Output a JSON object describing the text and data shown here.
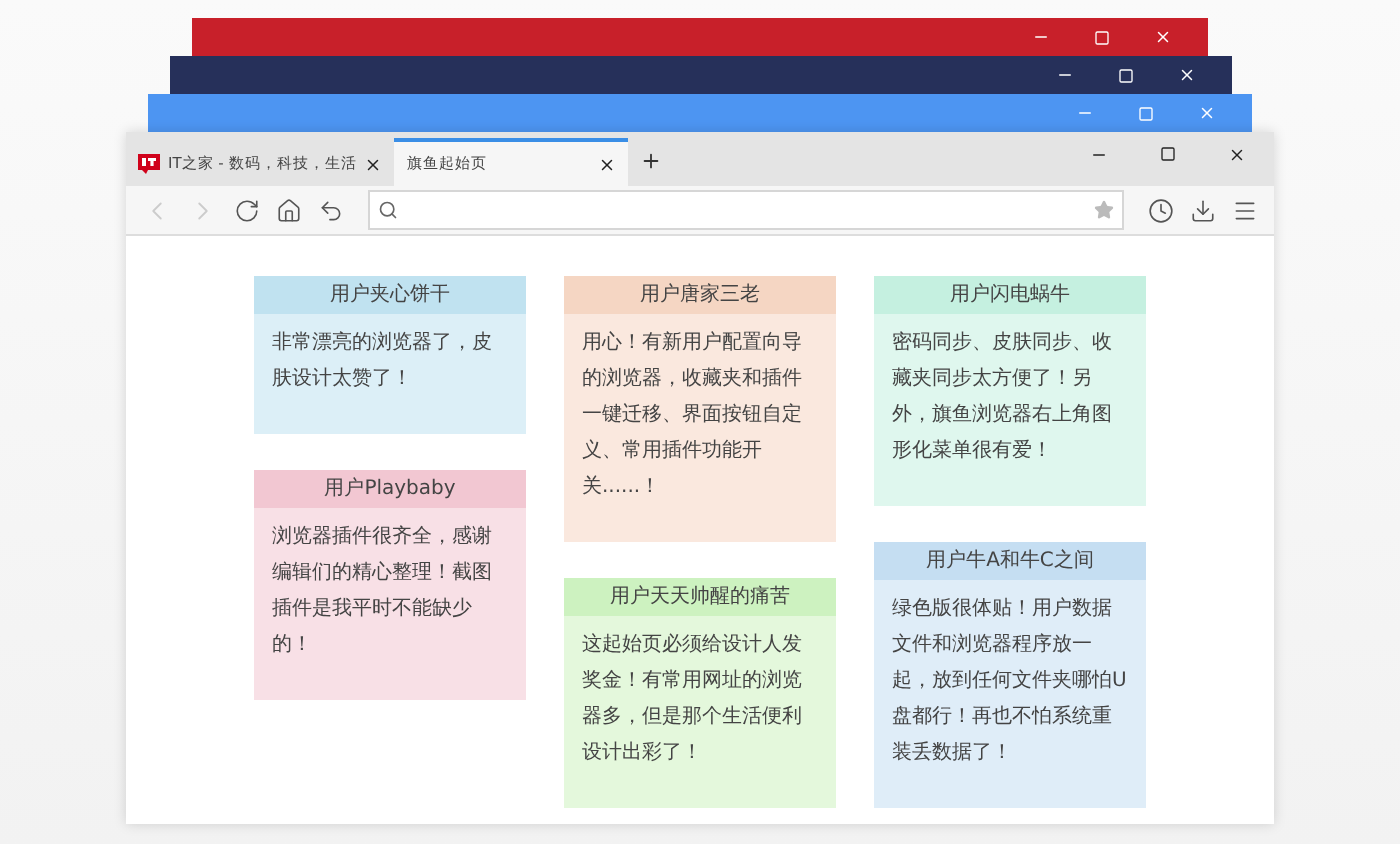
{
  "back_windows": [
    {
      "color": "#c8202a"
    },
    {
      "color": "#26305a"
    },
    {
      "color": "#4d95f2"
    }
  ],
  "tabs": [
    {
      "label": "IT之家 - 数码，科技，生活",
      "selected": false,
      "favicon": true
    },
    {
      "label": "旗鱼起始页",
      "selected": true,
      "favicon": false
    }
  ],
  "columns": [
    {
      "cards": [
        {
          "user": "用户夹心饼干",
          "text": "非常漂亮的浏览器了，皮肤设计太赞了！",
          "color": "#c0e2f0"
        },
        {
          "user": "用户Playbaby",
          "text": "浏览器插件很齐全，感谢编辑们的精心整理！截图插件是我平时不能缺少的！",
          "color": "#f2c7d2"
        }
      ]
    },
    {
      "cards": [
        {
          "user": "用户唐家三老",
          "text": "用心！有新用户配置向导的浏览器，收藏夹和插件一键迁移、界面按钮自定义、常用插件功能开关......！",
          "color": "#f5d6c3"
        },
        {
          "user": "用户天天帅醒的痛苦",
          "text": "这起始页必须给设计人发奖金！有常用网址的浏览器多，但是那个生活便利设计出彩了！",
          "color": "#cdf2c0"
        }
      ]
    },
    {
      "cards": [
        {
          "user": "用户闪电蜗牛",
          "text": "密码同步、皮肤同步、收藏夹同步太方便了！另外，旗鱼浏览器右上角图形化菜单很有爱！",
          "color": "#c5f0e0"
        },
        {
          "user": "用户牛A和牛C之间",
          "text": "绿色版很体贴！用户数据文件和浏览器程序放一起，放到任何文件夹哪怕U盘都行！再也不怕系统重装丢数据了！",
          "color": "#c5def2"
        }
      ]
    }
  ]
}
